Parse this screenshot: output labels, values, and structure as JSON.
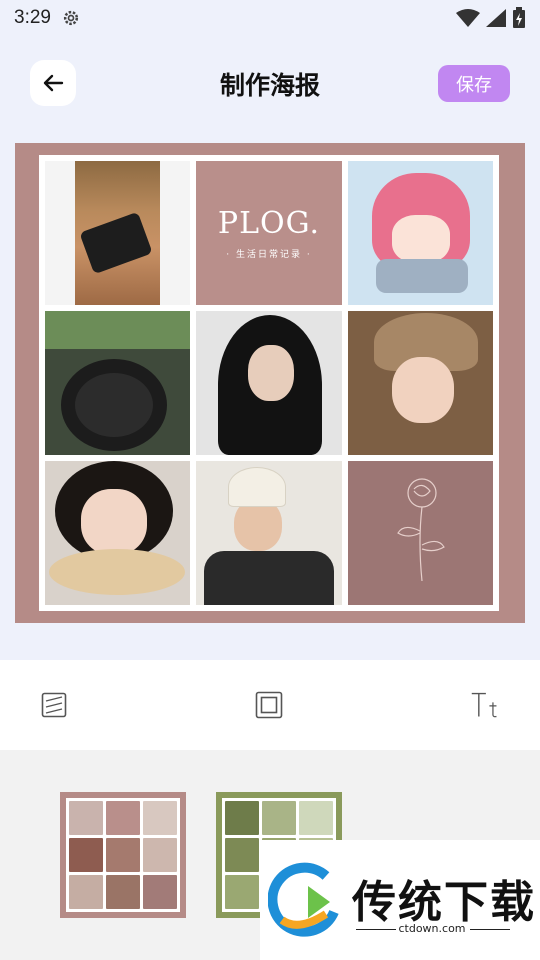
{
  "status_bar": {
    "time": "3:29"
  },
  "header": {
    "title": "制作海报",
    "save_label": "保存"
  },
  "poster": {
    "plog_title": "PLOG.",
    "plog_subtitle": "· 生活日常记录 ·"
  },
  "watermark": {
    "text": "传统下载",
    "url": "ctdown.com"
  },
  "colors": {
    "accent": "#c187f1",
    "poster_frame": "#b58b87",
    "template_1_frame": "#b58b87",
    "template_2_frame": "#8a9a5b"
  }
}
